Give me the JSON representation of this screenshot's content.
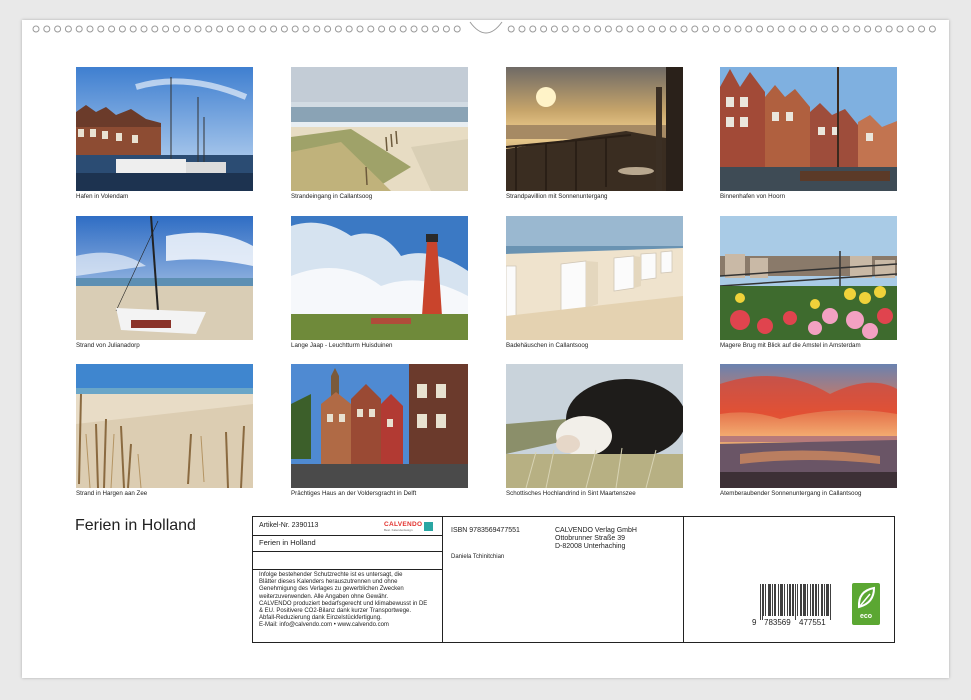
{
  "calendar": {
    "title": "Ferien in Holland"
  },
  "photos": [
    {
      "caption": "Hafen in Volendam",
      "scene": "harbor-houses"
    },
    {
      "caption": "Strandeingang in Callantsoog",
      "scene": "dunes"
    },
    {
      "caption": "Strandpavillion mit Sonnenuntergang",
      "scene": "pavilion-sunset"
    },
    {
      "caption": "Binnenhafen von Hoorn",
      "scene": "old-harbor"
    },
    {
      "caption": "Strand von Julianadorp",
      "scene": "catamaran"
    },
    {
      "caption": "Lange Jaap - Leuchtturm Huisduinen",
      "scene": "lighthouse"
    },
    {
      "caption": "Badehäuschen in Callantsoog",
      "scene": "beach-huts"
    },
    {
      "caption": "Magere Brug mit Blick auf die Amstel in Amsterdam",
      "scene": "tulips"
    },
    {
      "caption": "Strand in Hargen aan Zee",
      "scene": "beach-fence"
    },
    {
      "caption": "Prächtiges Haus an der Voldersgracht in Delft",
      "scene": "delft-houses"
    },
    {
      "caption": "Schottisches Hochlandrind in Sint Maartenszee",
      "scene": "cow"
    },
    {
      "caption": "Atemberaubender Sonnenuntergang in Callantsoog",
      "scene": "red-sunset"
    }
  ],
  "info": {
    "article_label": "Artikel-Nr. 2390113",
    "logo_text": "CALVENDO",
    "logo_sub": "Best. Kalenderdesign",
    "box_title": "Ferien in Holland",
    "legal_lines": [
      "Infolge bestehender Schutzrechte ist es untersagt, die",
      "Blätter dieses Kalenders herauszutrennen und ohne",
      "Genehmigung des Verlages zu gewerblichen Zwecken",
      "weiterzuverwenden. Alle Angaben ohne Gewähr.",
      "CALVENDO produziert bedarfsgerecht und klimabewusst in DE",
      "& EU. Positivere CO2-Bilanz dank kurzer Transportwege.",
      "Abfall-Reduzierung dank Einzelstückfertigung.",
      "E-Mail: info@calvendo.com • www.calvendo.com"
    ],
    "isbn": "ISBN 9783569477551",
    "author": "Daniela Tchinitchian",
    "publisher_lines": [
      "CALVENDO Verlag GmbH",
      "Ottobrunner Straße 39",
      "D-82008 Unterhaching"
    ],
    "barcode_digits": [
      "9",
      "783569",
      "477551"
    ],
    "eco_label": "eco"
  },
  "colors": {
    "accent": "#e2312d",
    "eco_green": "#5ba732",
    "border": "#222222"
  }
}
